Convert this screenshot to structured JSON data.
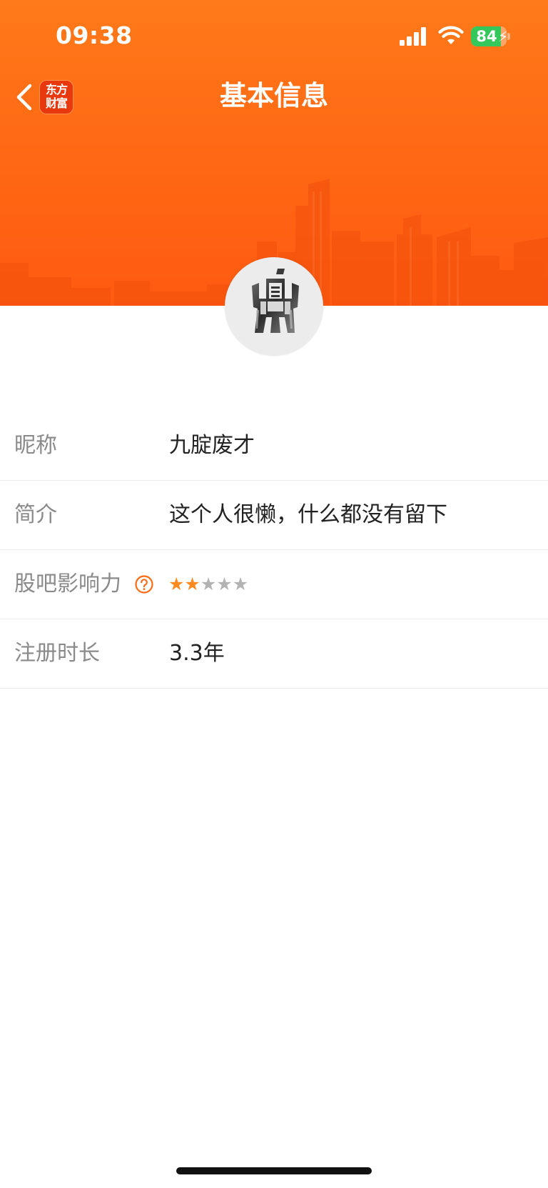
{
  "status_bar": {
    "time": "09:38",
    "battery_level": "84",
    "battery_fraction": 0.84,
    "battery_color": "#34c759",
    "icons": [
      "signal-icon",
      "wifi-icon",
      "battery-charging-icon"
    ]
  },
  "nav": {
    "back_icon": "chevron-left-icon",
    "app_logo_line1": "东方",
    "app_logo_line2": "财富",
    "title": "基本信息"
  },
  "theme": {
    "banner_color": "#ff6a14",
    "accent_color": "#ff8a1f",
    "label_color": "#8a8a8a",
    "value_color": "#222222"
  },
  "profile": {
    "avatar_icon": "ding-logo-avatar",
    "rows": [
      {
        "label": "昵称",
        "value": "九腚废才"
      },
      {
        "label": "简介",
        "value": "这个人很懒，什么都没有留下"
      },
      {
        "label": "股吧影响力",
        "help_icon": "question-circle-icon",
        "rating": 2,
        "rating_max": 5
      },
      {
        "label": "注册时长",
        "value": "3.3年"
      }
    ]
  }
}
